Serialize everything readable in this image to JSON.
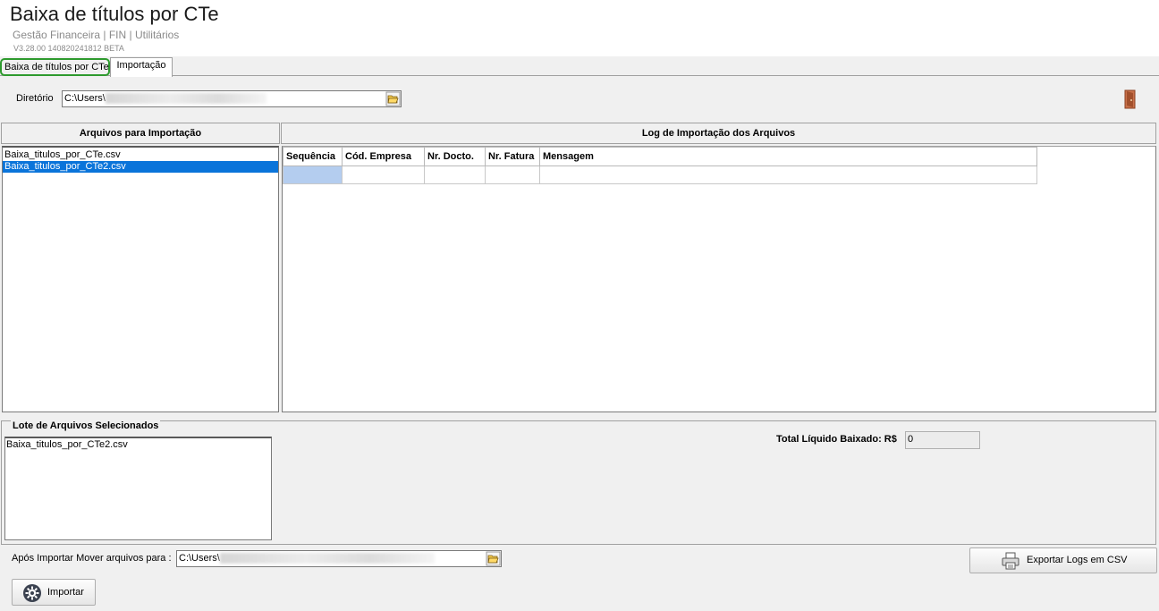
{
  "header": {
    "title": "Baixa de títulos por CTe",
    "breadcrumb": "Gestão Financeira | FIN | Utilitários",
    "version": "V3.28.00 140820241812 BETA"
  },
  "tabs": [
    {
      "label": "Baixa de títulos por CTe",
      "active": true
    },
    {
      "label": "Importação",
      "active": false
    }
  ],
  "directory": {
    "label": "Diretório",
    "value": "C:\\Users\\",
    "icon": "folder-open-icon"
  },
  "exit_icon": "door-exit-icon",
  "files_panel": {
    "header": "Arquivos para Importação",
    "items": [
      {
        "name": "Baixa_titulos_por_CTe.csv",
        "selected": false
      },
      {
        "name": "Baixa_titulos_por_CTe2.csv",
        "selected": true
      }
    ]
  },
  "log_panel": {
    "header": "Log de Importação dos Arquivos",
    "columns": [
      "Sequência",
      "Cód. Empresa",
      "Nr. Docto.",
      "Nr. Fatura",
      "Mensagem"
    ],
    "rows": [
      [
        "",
        "",
        "",
        "",
        ""
      ]
    ]
  },
  "lote": {
    "title": "Lote de Arquivos Selecionados",
    "items": [
      "Baixa_titulos_por_CTe2.csv"
    ]
  },
  "total": {
    "label": "Total Líquido Baixado: R$",
    "value": "0"
  },
  "move_dir": {
    "label": "Após Importar Mover arquivos para :",
    "value": "C:\\Users\\",
    "icon": "folder-open-icon"
  },
  "buttons": {
    "export": {
      "label": "Exportar Logs em CSV",
      "icon": "printer-icon"
    },
    "import": {
      "label": "Importar",
      "icon": "gear-icon"
    }
  },
  "colors": {
    "selection": "#0a74da",
    "active_tab_border": "#2e9a2e",
    "current_cell": "#b4cdef"
  }
}
